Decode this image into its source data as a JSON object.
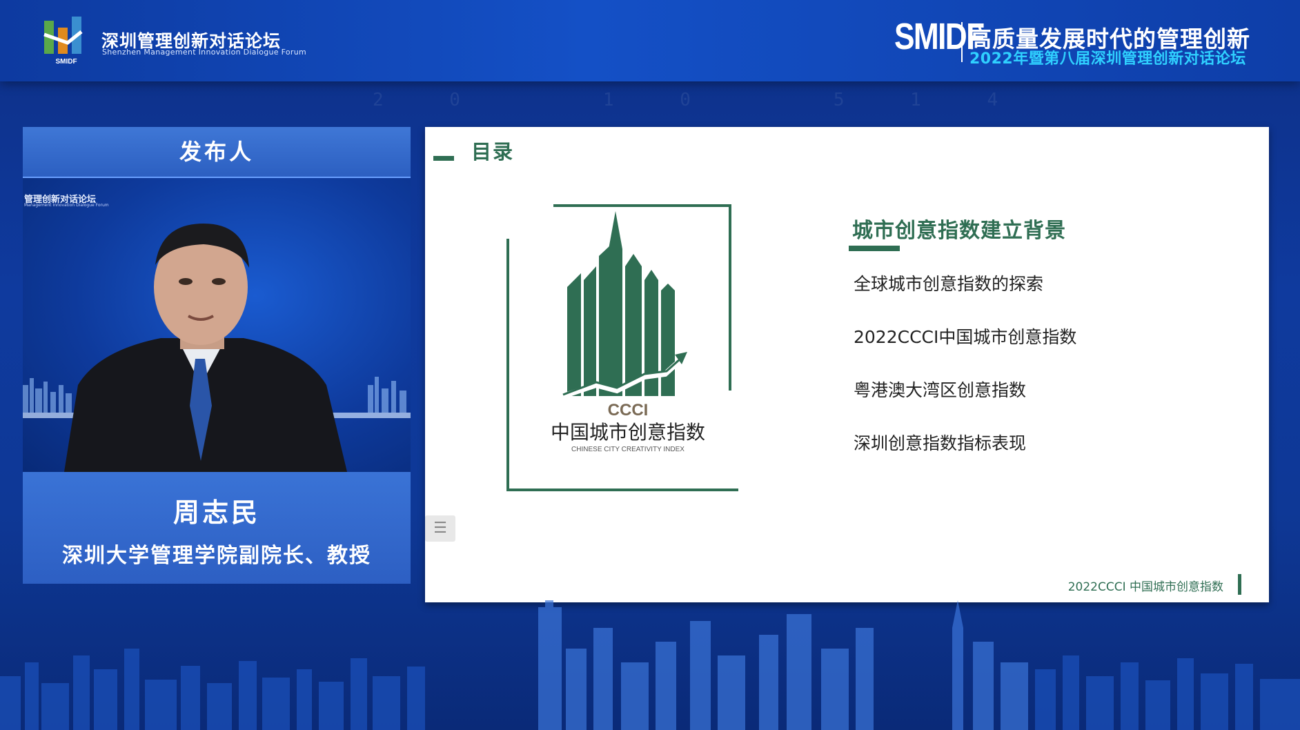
{
  "header": {
    "brand_cn": "深圳管理创新对话论坛",
    "brand_en": "Shenzhen Management Innovation Dialogue Forum",
    "logo_sub": "SMIDF",
    "event_brand": "SMIDF",
    "event_title": "高质量发展时代的管理创新",
    "event_subtitle": "2022年暨第八届深圳管理创新对话论坛"
  },
  "speaker": {
    "header_label": "发布人",
    "video_caption_cn": "管理创新对话论坛",
    "video_caption_en": "Management Innovation Dialogue Forum",
    "name": "周志民",
    "title": "深圳大学管理学院副院长、教授"
  },
  "slide": {
    "heading": "目录",
    "logo_abbr": "CCCI",
    "logo_cn": "中国城市创意指数",
    "logo_en": "CHINESE CITY CREATIVITY INDEX",
    "section_title": "城市创意指数建立背景",
    "items": [
      "全球城市创意指数的探索",
      "2022CCCI中国城市创意指数",
      "粤港澳大湾区创意指数",
      "深圳创意指数指标表现"
    ],
    "footer": "2022CCCI 中国城市创意指数",
    "menu_icon": "list-icon"
  },
  "colors": {
    "accent_green": "#2f6e53",
    "sub_cyan": "#2fd0ff",
    "bg_blue": "#0f3a9e"
  }
}
